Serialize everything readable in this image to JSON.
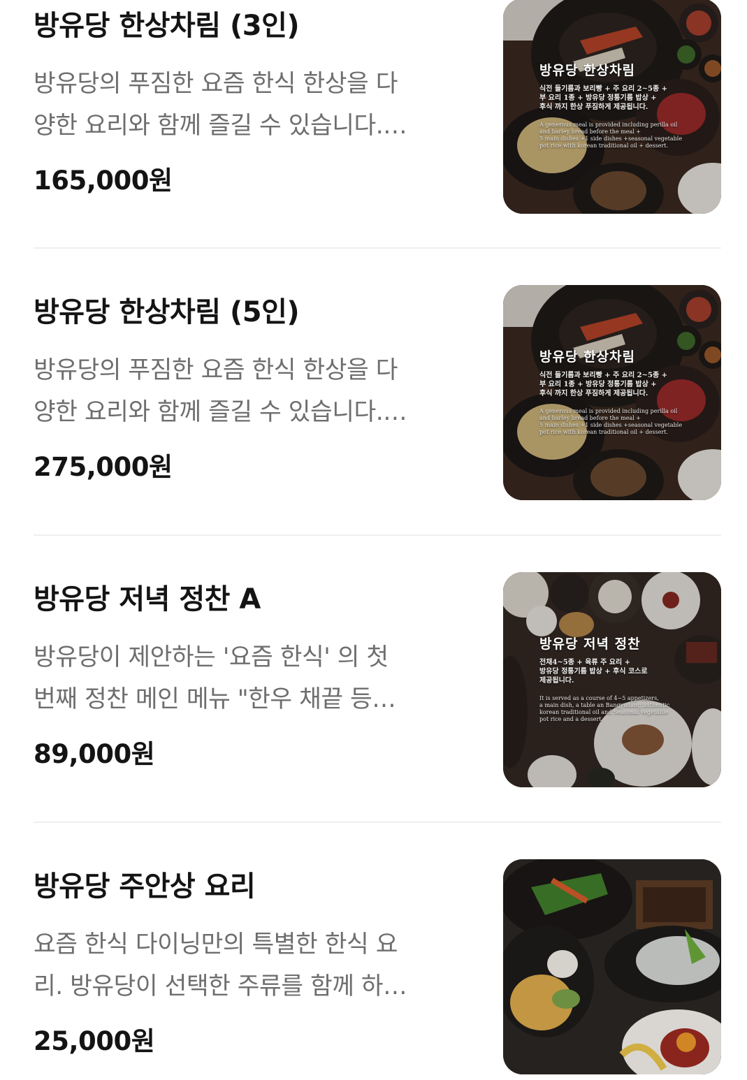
{
  "menu": {
    "items": [
      {
        "name": "방유당 한상차림 (3인)",
        "desc_line1": "방유당의 푸짐한 요즘 한식 한상을 다",
        "desc_line2": "양한 요리와 함께 즐길 수 있습니다.…",
        "price": "165,000원",
        "photo": {
          "title": "방유당 한상차림",
          "sub1": "식전 들기름과 보리빵 + 주 요리 2~5종 +",
          "sub2": "부 요리 1종 + 방유당 정통기름 밥상 +",
          "sub3": "후식 까지 한상 푸짐하게 제공됩니다.",
          "en1": "A generous meal is provided including perilla oil",
          "en2": "and barley bread before the meal +",
          "en3": "5 main dishes +1 side dishes +seasonal vegetable",
          "en4": "pot rice with korean traditional oil + dessert."
        }
      },
      {
        "name": "방유당 한상차림 (5인)",
        "desc_line1": "방유당의 푸짐한 요즘 한식 한상을 다",
        "desc_line2": "양한 요리와 함께 즐길 수 있습니다.…",
        "price": "275,000원",
        "photo": {
          "title": "방유당 한상차림",
          "sub1": "식전 들기름과 보리빵 + 주 요리 2~5종 +",
          "sub2": "부 요리 1종 + 방유당 정통기름 밥상 +",
          "sub3": "후식 까지 한상 푸짐하게 제공됩니다.",
          "en1": "A generous meal is provided including perilla oil",
          "en2": "and barley bread before the meal +",
          "en3": "5 main dishes +1 side dishes +seasonal vegetable",
          "en4": "pot rice with korean traditional oil + dessert."
        }
      },
      {
        "name": "방유당 저녁 정찬 A",
        "desc_line1": "방유당이 제안하는 '요즘 한식' 의 첫",
        "desc_line2": "번째 정찬 메인 메뉴 \"한우 채끝 등…",
        "price": "89,000원",
        "photo": {
          "title": "방유당 저녁 정찬",
          "sub1": "전채4~5종 + 육류 주 요리 +",
          "sub2": "방유당 정통기름 밥상 + 후식 코스로",
          "sub3": "제공됩니다.",
          "en1": "It is served as a course of 4~5 appetizers,",
          "en2": "a main dish, a table an Bangyudang authentic",
          "en3": "korean traditional oil and Seasonal vegetable",
          "en4": "pot rice and a dessert"
        }
      },
      {
        "name": "방유당 주안상 요리",
        "desc_line1": "요즘 한식 다이닝만의 특별한 한식 요",
        "desc_line2": "리. 방유당이 선택한 주류를 함께 하…",
        "price": "25,000원"
      }
    ]
  },
  "colors": {
    "title": "#141414",
    "description": "#6e6e6e",
    "divider": "#efefef",
    "background": "#ffffff"
  }
}
